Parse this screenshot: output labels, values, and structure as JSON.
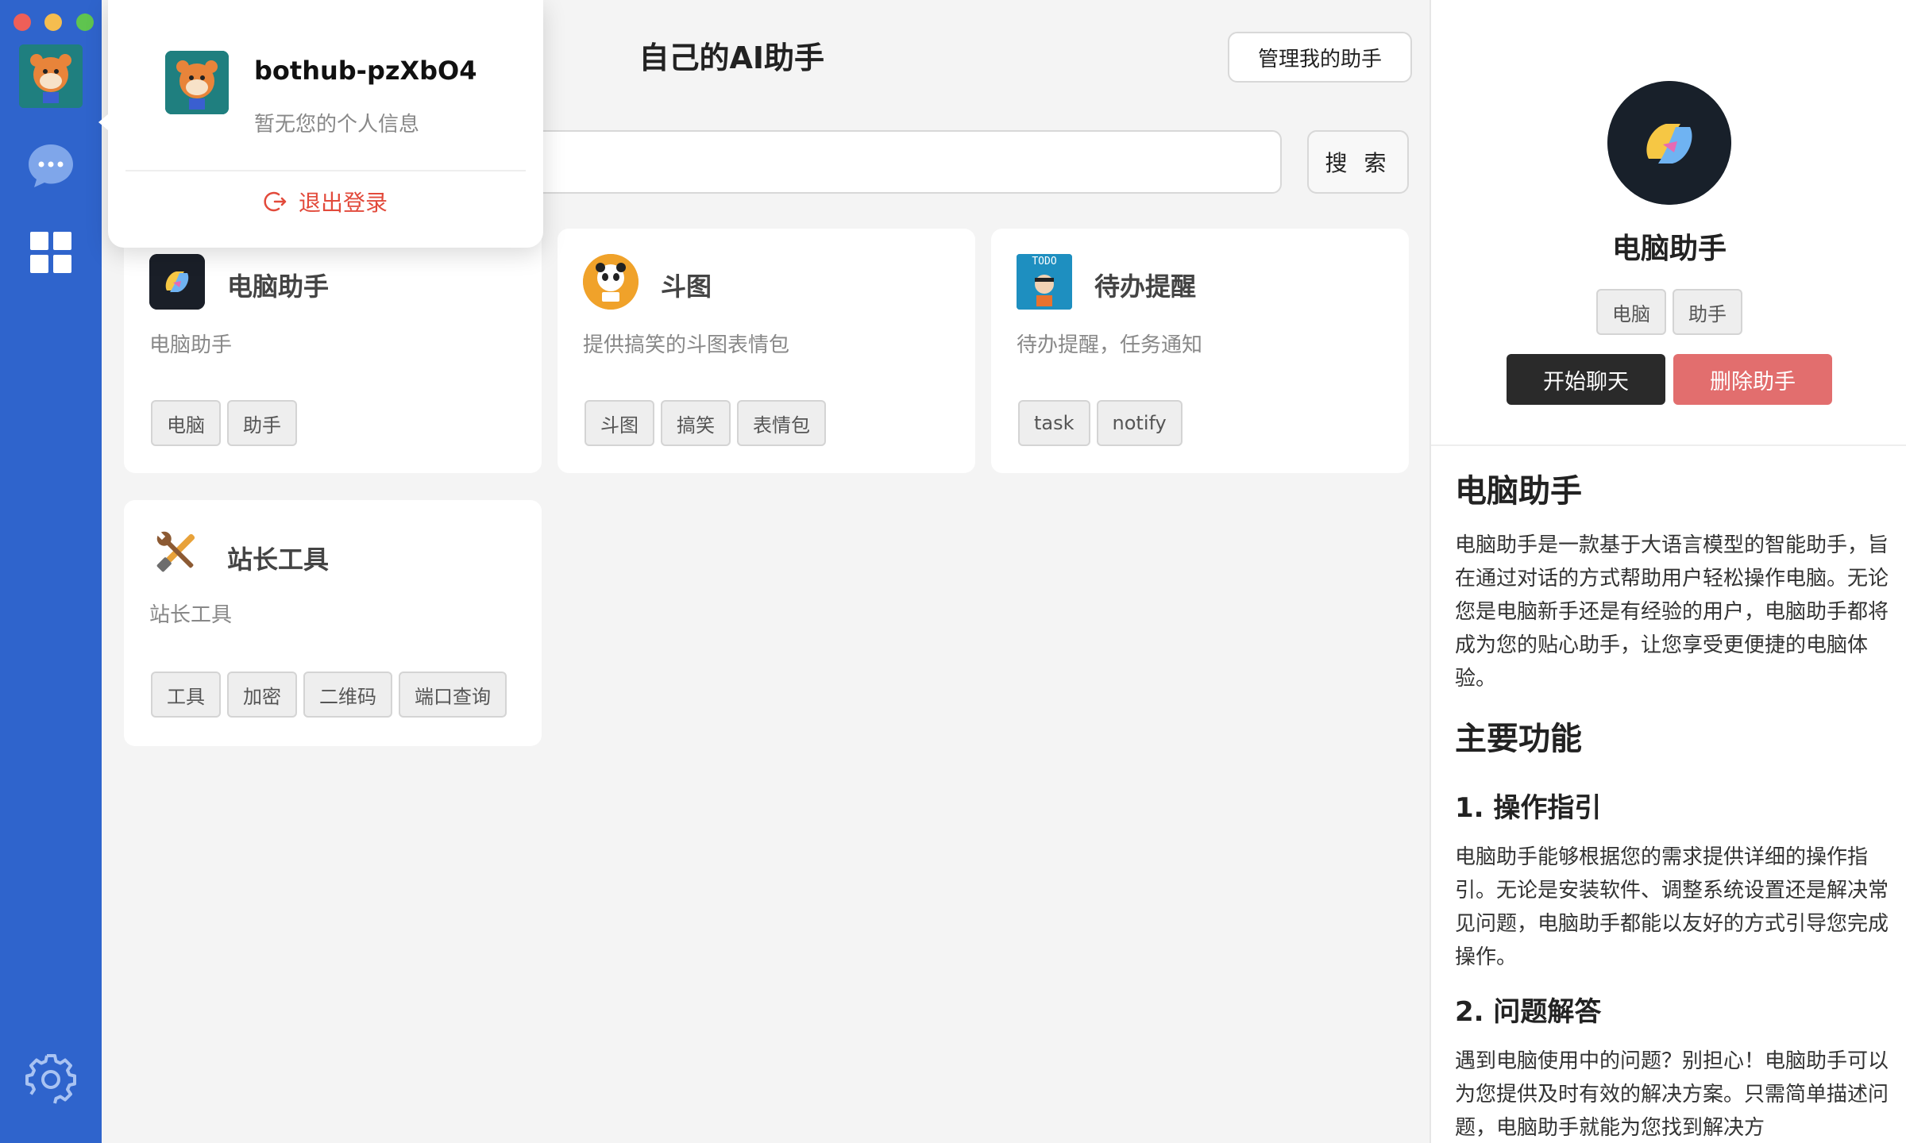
{
  "window": {
    "page_title": "自己的AI助手",
    "manage_label": "管理我的助手",
    "search": {
      "value": "",
      "placeholder": "",
      "button_label": "搜 索"
    }
  },
  "user_popover": {
    "username": "bothub-pzXbO4",
    "info": "暂无您的个人信息",
    "logout_label": "退出登录"
  },
  "assistants": [
    {
      "name": "电脑助手",
      "desc": "电脑助手",
      "tags": [
        "电脑",
        "助手"
      ],
      "icon": "copilot-logo-icon"
    },
    {
      "name": "斗图",
      "desc": "提供搞笑的斗图表情包",
      "tags": [
        "斗图",
        "搞笑",
        "表情包"
      ],
      "icon": "panda-meme-icon"
    },
    {
      "name": "待办提醒",
      "desc": "待办提醒，任务通知",
      "tags": [
        "task",
        "notify"
      ],
      "icon": "todo-icon",
      "icon_text": "TODO"
    },
    {
      "name": "站长工具",
      "desc": "站长工具",
      "tags": [
        "工具",
        "加密",
        "二维码",
        "端口查询"
      ],
      "icon": "tools-icon"
    }
  ],
  "detail": {
    "name": "电脑助手",
    "tags": [
      "电脑",
      "助手"
    ],
    "start_label": "开始聊天",
    "delete_label": "删除助手",
    "doc": {
      "h1": "电脑助手",
      "intro": "电脑助手是一款基于大语言模型的智能助手，旨在通过对话的方式帮助用户轻松操作电脑。无论您是电脑新手还是有经验的用户，电脑助手都将成为您的贴心助手，让您享受更便捷的电脑体验。",
      "h2": "主要功能",
      "s1_title": "1. 操作指引",
      "s1_text": "电脑助手能够根据您的需求提供详细的操作指引。无论是安装软件、调整系统设置还是解决常见问题，电脑助手都能以友好的方式引导您完成操作。",
      "s2_title": "2. 问题解答",
      "s2_text": "遇到电脑使用中的问题？别担心！电脑助手可以为您提供及时有效的解决方案。只需简单描述问题，电脑助手就能为您找到解决方"
    }
  },
  "colors": {
    "sidebar": "#2f64cc",
    "accent_danger": "#e26e6e",
    "logout": "#e24a3b",
    "primary_dark": "#2a2a2a"
  }
}
